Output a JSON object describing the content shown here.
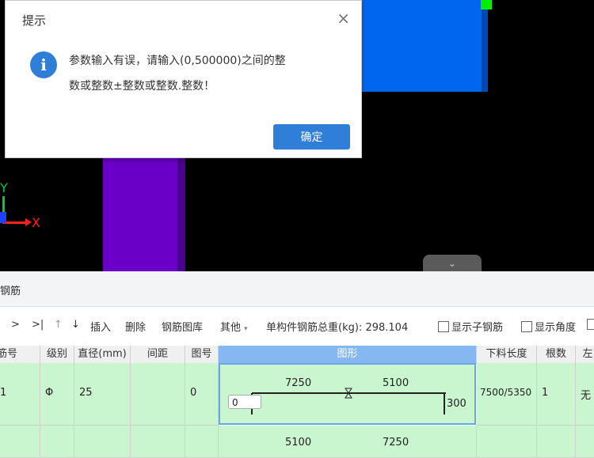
{
  "dialog": {
    "title": "提示",
    "close_glyph": "×",
    "icon_glyph": "i",
    "message_line1": "参数输入有误，请输入(0,500000)之间的整",
    "message_line2": "数或整数±整数或整数.整数！",
    "ok_label": "确定"
  },
  "viewport": {
    "axis_x": "X",
    "axis_y": "Y",
    "collapse_glyph": "⌄"
  },
  "panel": {
    "title": "钢筋"
  },
  "toolbar": {
    "nav_next": ">",
    "nav_last": ">|",
    "move_up": "↑",
    "move_down": "↓",
    "insert": "插入",
    "delete": "删除",
    "library": "钢筋图库",
    "other": "其他",
    "other_caret": "▾",
    "total_weight_label": "单构件钢筋总重(kg):",
    "total_weight_value": "298.104",
    "show_sub": "显示子钢筋",
    "show_angle": "显示角度"
  },
  "table": {
    "headers": [
      "筋号",
      "级别",
      "直径(mm)",
      "间距",
      "图号",
      "图形",
      "下料长度",
      "根数",
      "左"
    ],
    "row1": {
      "no": "1",
      "grade": "Φ",
      "diameter": "25",
      "spacing": "",
      "figure_no": "0",
      "dim_left": "7250",
      "dim_right": "5100",
      "dim_start": "0",
      "dim_end": "300",
      "cut_length": "7500/5350",
      "count": "1",
      "left": "无"
    },
    "row2": {
      "dim_left": "5100",
      "dim_right": "7250"
    }
  }
}
